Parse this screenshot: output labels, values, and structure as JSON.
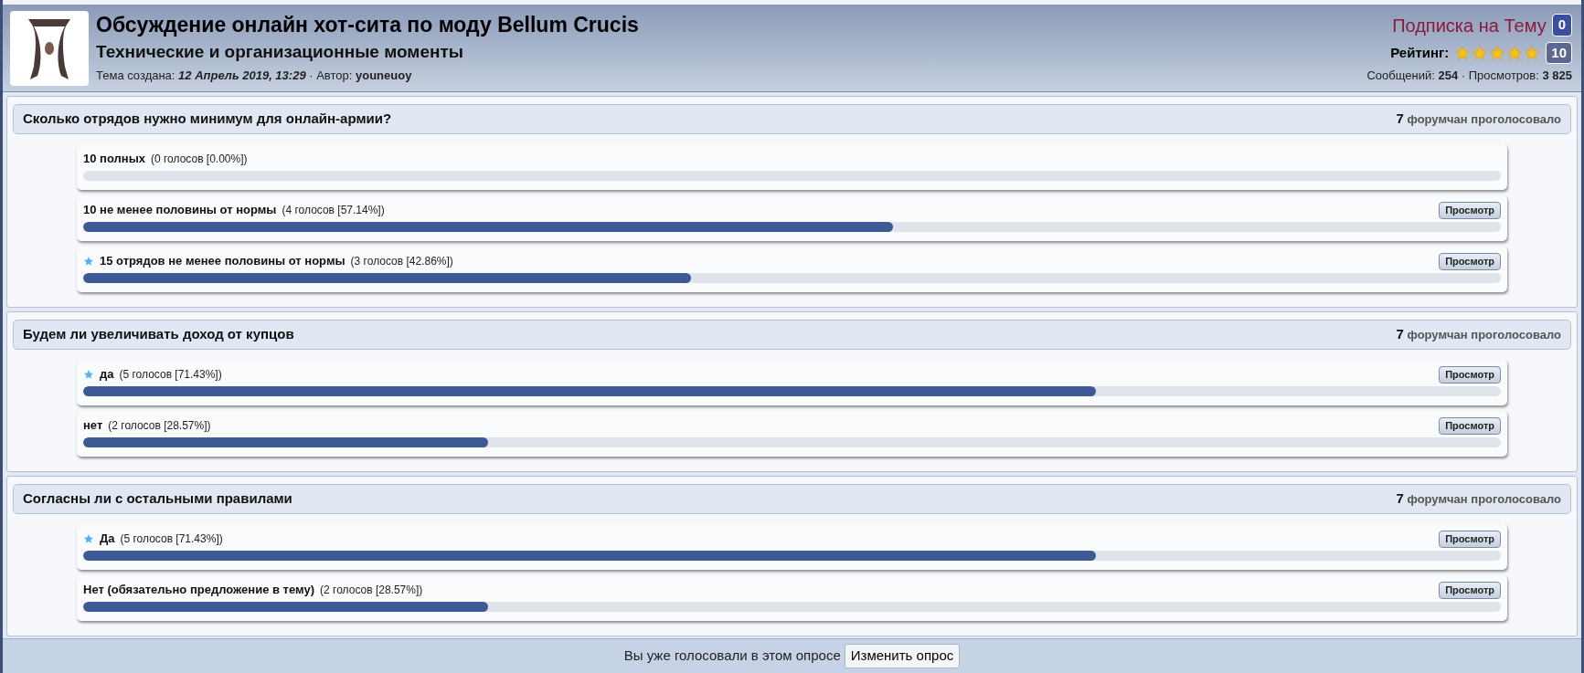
{
  "topic": {
    "title": "Обсуждение онлайн хот-сита по моду Bellum Crucis",
    "subtitle": "Технические и организационные моменты",
    "created_label": "Тема создана:",
    "created_date": "12 Апрель 2019, 13:29",
    "separator": "·",
    "author_label": "Автор:",
    "author": "youneuoy"
  },
  "subscription": {
    "label": "Подписка на Тему",
    "count": "0"
  },
  "rating": {
    "label": "Рейтинг:",
    "stars": 5,
    "count": "10"
  },
  "stats": "Сообщений: **254** · Просмотров: **3 825**",
  "polls": [
    {
      "question": "Сколько отрядов нужно минимум для онлайн-армии?",
      "voters": "7",
      "voters_label": "форумчан проголосовало",
      "options": [
        {
          "label": "10 полных",
          "result": "(0 голосов [0.00%])",
          "voted": false
        },
        {
          "label": "10 не менее половины от нормы",
          "result": "(4 голосов [57.14%])",
          "level": 0.5714,
          "voted": false,
          "view_button": "Просмотр"
        },
        {
          "label": "15 отрядов не менее половины от нормы",
          "result": "(3 голосов [42.86%])",
          "level": 0.4286,
          "voted": true,
          "view_button": "Просмотр"
        }
      ]
    },
    {
      "question": "Будем ли увеличивать доход от купцов",
      "voters": "7",
      "voters_label": "форумчан проголосовало",
      "options": [
        {
          "label": "да",
          "result": "(5 голосов [71.43%])",
          "level": 0.7143,
          "voted": true,
          "view_button": "Просмотр"
        },
        {
          "label": "нет",
          "result": "(2 голосов [28.57%])",
          "level": 0.2857,
          "voted": false,
          "view_button": "Просмотр"
        }
      ]
    },
    {
      "question": "Согласны ли с остальными правилами",
      "voters": "7",
      "voters_label": "форумчан проголосовало",
      "options": [
        {
          "label": "Да",
          "result": "(5 голосов [71.43%])",
          "level": 0.7143,
          "voted": true,
          "view_button": "Просмотр"
        },
        {
          "label": "Нет (обязательно предложение в тему)",
          "result": "(2 голосов [28.57%])",
          "level": 0.2857,
          "voted": false,
          "view_button": "Просмотр"
        }
      ]
    }
  ],
  "footer": {
    "message": "Вы уже голосовали в этом опросе",
    "button": "Изменить опрос"
  }
}
